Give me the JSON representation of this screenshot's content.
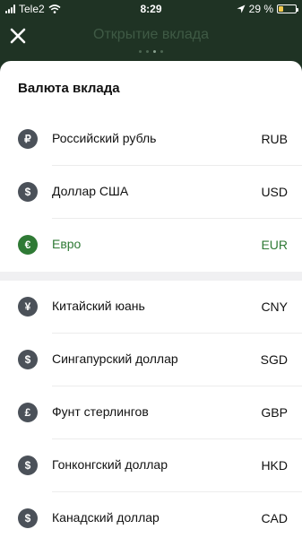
{
  "status_bar": {
    "carrier": "Tele2",
    "time": "8:29",
    "battery_text": "29 %",
    "battery_level": 0.29,
    "battery_color": "#f2c94c"
  },
  "header": {
    "title": "Открытие вклада",
    "step_dots_total": 4,
    "step_dots_active": 3
  },
  "sheet": {
    "title": "Валюта вклада",
    "accent_color": "#2f7a35",
    "groups": [
      [
        {
          "symbol": "₽",
          "icon": "ruble-icon",
          "name": "Российский рубль",
          "code": "RUB",
          "selected": false
        },
        {
          "symbol": "$",
          "icon": "dollar-icon",
          "name": "Доллар США",
          "code": "USD",
          "selected": false
        },
        {
          "symbol": "€",
          "icon": "euro-icon",
          "name": "Евро",
          "code": "EUR",
          "selected": true
        }
      ],
      [
        {
          "symbol": "¥",
          "icon": "yuan-icon",
          "name": "Китайский юань",
          "code": "CNY",
          "selected": false
        },
        {
          "symbol": "$",
          "icon": "dollar-icon",
          "name": "Сингапурский доллар",
          "code": "SGD",
          "selected": false
        },
        {
          "symbol": "£",
          "icon": "pound-icon",
          "name": "Фунт стерлингов",
          "code": "GBP",
          "selected": false
        },
        {
          "symbol": "$",
          "icon": "dollar-icon",
          "name": "Гонконгский доллар",
          "code": "HKD",
          "selected": false
        },
        {
          "symbol": "$",
          "icon": "dollar-icon",
          "name": "Канадский доллар",
          "code": "CAD",
          "selected": false
        }
      ]
    ]
  }
}
